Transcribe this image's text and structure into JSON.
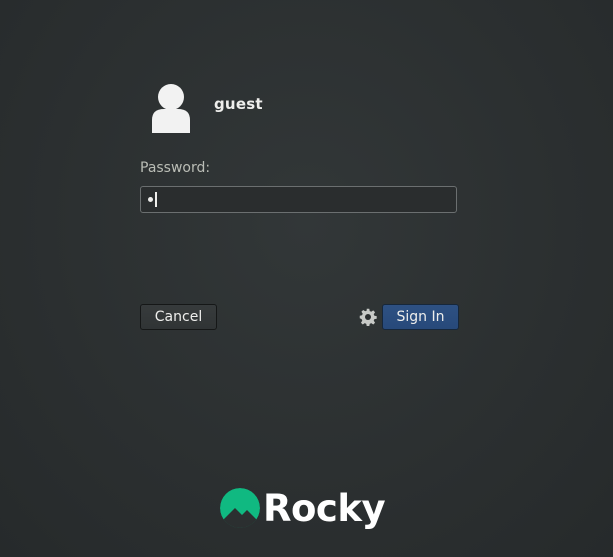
{
  "login": {
    "username": "guest",
    "password_label": "Password:",
    "password_value": "•",
    "cancel_label": "Cancel",
    "signin_label": "Sign In",
    "session_icon": "gear-icon"
  },
  "branding": {
    "logo_text": "Rocky",
    "logo_color": "#10b981"
  },
  "colors": {
    "background": "#2b2f30",
    "signin_button": "#2a4c7d",
    "field_border": "#6b6f70",
    "text": "#eeeeec"
  }
}
